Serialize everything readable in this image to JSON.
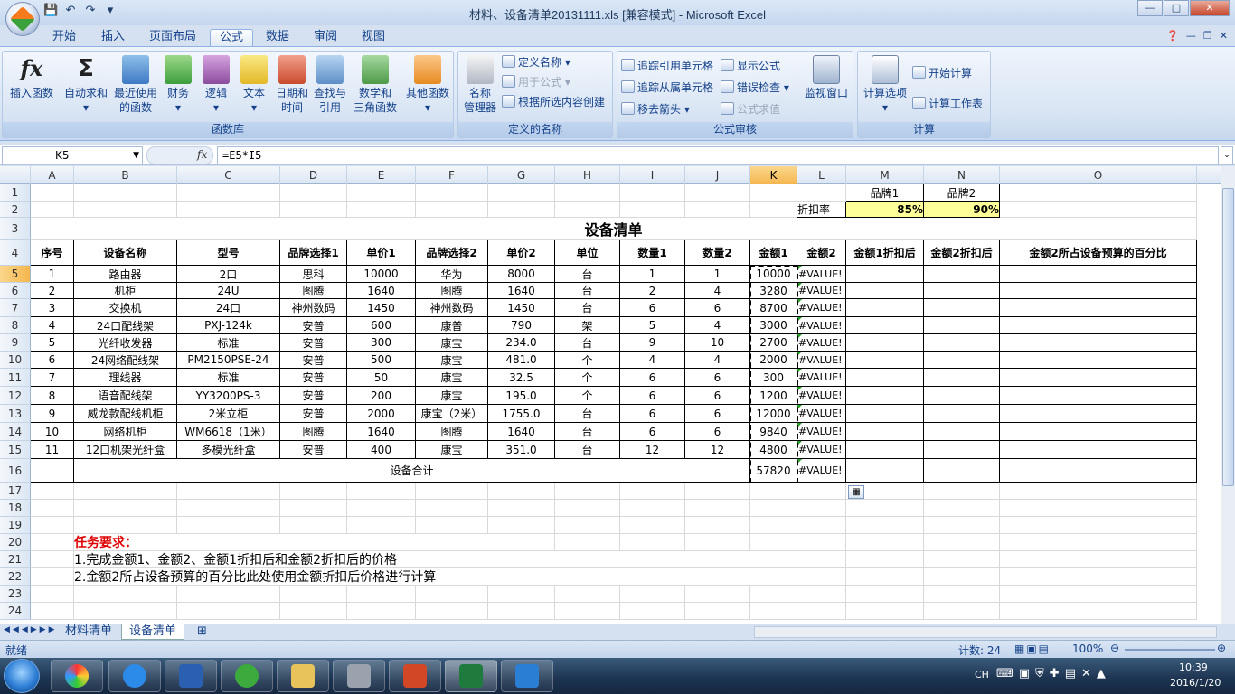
{
  "window": {
    "title": "材料、设备清单20131111.xls  [兼容模式] - Microsoft Excel",
    "min": "—",
    "max": "□",
    "close": "✕"
  },
  "qat": [
    "save-icon",
    "undo-icon",
    "redo-icon",
    "customize-icon"
  ],
  "tabs": [
    "开始",
    "插入",
    "页面布局",
    "公式",
    "数据",
    "审阅",
    "视图"
  ],
  "active_tab": "公式",
  "ribbon": {
    "func_lib": {
      "label": "函数库",
      "insert": "插入函数",
      "autosum": "自动求和",
      "recent": "最近使用\n的函数",
      "finance": "财务",
      "logic": "逻辑",
      "text": "文本",
      "datetime": "日期和\n时间",
      "lookup": "查找与\n引用",
      "math": "数学和\n三角函数",
      "other": "其他函数"
    },
    "names": {
      "label": "定义的名称",
      "manager": "名称\n管理器",
      "define": "定义名称",
      "use": "用于公式",
      "create": "根据所选内容创建"
    },
    "audit": {
      "label": "公式审核",
      "trace_prec": "追踪引用单元格",
      "trace_dep": "追踪从属单元格",
      "remove": "移去箭头",
      "show": "显示公式",
      "check": "错误检查",
      "eval": "公式求值",
      "watch": "监视窗口"
    },
    "calc": {
      "label": "计算",
      "options": "计算选项",
      "calc_now": "开始计算",
      "calc_sheet": "计算工作表"
    }
  },
  "namebox": "K5",
  "formula": "=E5*I5",
  "columns": [
    "A",
    "B",
    "C",
    "D",
    "E",
    "F",
    "G",
    "H",
    "I",
    "J",
    "K",
    "L",
    "M",
    "N",
    "O"
  ],
  "rows": [
    "1",
    "2",
    "3",
    "4",
    "5",
    "6",
    "7",
    "8",
    "9",
    "10",
    "11",
    "12",
    "13",
    "14",
    "15",
    "16",
    "17",
    "18",
    "19",
    "20",
    "21",
    "22",
    "23",
    "24"
  ],
  "brand_header": {
    "m": "品牌1",
    "n": "品牌2"
  },
  "discount": {
    "label": "折扣率",
    "m": "85%",
    "n": "90%"
  },
  "sheet_title": "设备清单",
  "headers": [
    "序号",
    "设备名称",
    "型号",
    "品牌选择1",
    "单价1",
    "品牌选择2",
    "单价2",
    "单位",
    "数量1",
    "数量2",
    "金额1",
    "金额2",
    "金额1折扣后",
    "金额2折扣后",
    "金额2所占设备预算的百分比"
  ],
  "table": [
    [
      "1",
      "路由器",
      "2口",
      "思科",
      "10000",
      "华为",
      "8000",
      "台",
      "1",
      "1",
      "10000",
      "#VALUE!"
    ],
    [
      "2",
      "机柜",
      "24U",
      "图腾",
      "1640",
      "图腾",
      "1640",
      "台",
      "2",
      "4",
      "3280",
      "#VALUE!"
    ],
    [
      "3",
      "交换机",
      "24口",
      "神州数码",
      "1450",
      "神州数码",
      "1450",
      "台",
      "6",
      "6",
      "8700",
      "#VALUE!"
    ],
    [
      "4",
      "24口配线架",
      "PXJ-124k",
      "安普",
      "600",
      "康普",
      "790",
      "架",
      "5",
      "4",
      "3000",
      "#VALUE!"
    ],
    [
      "5",
      "光纤收发器",
      "标准",
      "安普",
      "300",
      "康宝",
      "234.0",
      "台",
      "9",
      "10",
      "2700",
      "#VALUE!"
    ],
    [
      "6",
      "24网络配线架",
      "PM2150PSE-24",
      "安普",
      "500",
      "康宝",
      "481.0",
      "个",
      "4",
      "4",
      "2000",
      "#VALUE!"
    ],
    [
      "7",
      "理线器",
      "标准",
      "安普",
      "50",
      "康宝",
      "32.5",
      "个",
      "6",
      "6",
      "300",
      "#VALUE!"
    ],
    [
      "8",
      "语音配线架",
      "YY3200PS-3",
      "安普",
      "200",
      "康宝",
      "195.0",
      "个",
      "6",
      "6",
      "1200",
      "#VALUE!"
    ],
    [
      "9",
      "威龙款配线机柜",
      "2米立柜",
      "安普",
      "2000",
      "康宝（2米）",
      "1755.0",
      "台",
      "6",
      "6",
      "12000",
      "#VALUE!"
    ],
    [
      "10",
      "网络机柜",
      "WM6618（1米）",
      "图腾",
      "1640",
      "图腾",
      "1640",
      "台",
      "6",
      "6",
      "9840",
      "#VALUE!"
    ],
    [
      "11",
      "12口机架光纤盒",
      "多模光纤盒",
      "安普",
      "400",
      "康宝",
      "351.0",
      "台",
      "12",
      "12",
      "4800",
      "#VALUE!"
    ]
  ],
  "total": {
    "label": "设备合计",
    "k": "57820",
    "l": "#VALUE!"
  },
  "task": {
    "title": "任务要求：",
    "line1": "1.完成金额1、金额2、金额1折扣后和金额2折扣后的价格",
    "line2": "2.金额2所占设备预算的百分比此处使用金额折扣后价格进行计算"
  },
  "sheets": [
    "材料清单",
    "设备清单"
  ],
  "active_sheet": "设备清单",
  "status": {
    "ready": "就绪",
    "count": "计数: 24",
    "zoom": "100%"
  },
  "tray": {
    "lang": "CH",
    "time": "10:39",
    "date": "2016/1/20"
  }
}
